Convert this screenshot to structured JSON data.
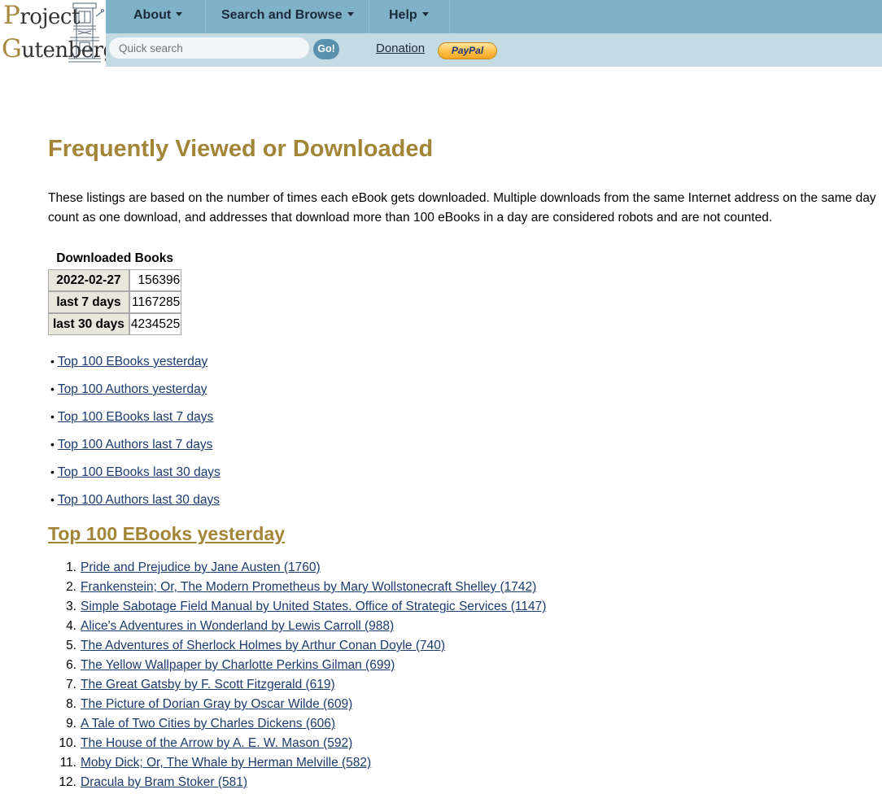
{
  "logo": {
    "word1_cap": "P",
    "word1_rest": "roject",
    "word2_cap": "G",
    "word2_rest": "utenberg"
  },
  "nav": {
    "about": "About",
    "search_browse": "Search and Browse",
    "help": "Help"
  },
  "search": {
    "placeholder": "Quick search",
    "go_label": "Go!"
  },
  "donation_label": "Donation",
  "paypal_label": "PayPal",
  "page_title": "Frequently Viewed or Downloaded",
  "intro": "These listings are based on the number of times each eBook gets downloaded. Multiple downloads from the same Internet address on the same day count as one download, and addresses that download more than 100 eBooks in a day are considered robots and are not counted.",
  "stats": {
    "caption": "Downloaded Books",
    "rows": [
      {
        "label": "2022-02-27",
        "value": "156396"
      },
      {
        "label": "last 7 days",
        "value": "1167285"
      },
      {
        "label": "last 30 days",
        "value": "4234525"
      }
    ]
  },
  "links": [
    "Top 100 EBooks yesterday",
    "Top 100 Authors yesterday",
    "Top 100 EBooks last 7 days",
    "Top 100 Authors last 7 days",
    "Top 100 EBooks last 30 days",
    "Top 100 Authors last 30 days"
  ],
  "section_heading": "Top 100 EBooks yesterday",
  "books": [
    {
      "num": "1.",
      "text": "Pride and Prejudice by Jane Austen (1760)"
    },
    {
      "num": "2.",
      "text": "Frankenstein; Or, The Modern Prometheus by Mary Wollstonecraft Shelley (1742)"
    },
    {
      "num": "3.",
      "text": "Simple Sabotage Field Manual by United States. Office of Strategic Services (1147)"
    },
    {
      "num": "4.",
      "text": "Alice's Adventures in Wonderland by Lewis Carroll (988)"
    },
    {
      "num": "5.",
      "text": "The Adventures of Sherlock Holmes by Arthur Conan Doyle (740)"
    },
    {
      "num": "6.",
      "text": "The Yellow Wallpaper by Charlotte Perkins Gilman (699)"
    },
    {
      "num": "7.",
      "text": "The Great Gatsby by F. Scott Fitzgerald (619)"
    },
    {
      "num": "8.",
      "text": "The Picture of Dorian Gray by Oscar Wilde (609)"
    },
    {
      "num": "9.",
      "text": "A Tale of Two Cities by Charles Dickens (606)"
    },
    {
      "num": "10.",
      "text": "The House of the Arrow by A. E. W. Mason (592)"
    },
    {
      "num": "11.",
      "text": "Moby Dick; Or, The Whale by Herman Melville (582)"
    },
    {
      "num": "12.",
      "text": "Dracula by Bram Stoker (581)"
    }
  ],
  "colors": {
    "accent": "#a38537",
    "nav_bg": "#7fb2c8",
    "subbar_bg": "#c5dbe4",
    "link": "#1a3b6e"
  }
}
